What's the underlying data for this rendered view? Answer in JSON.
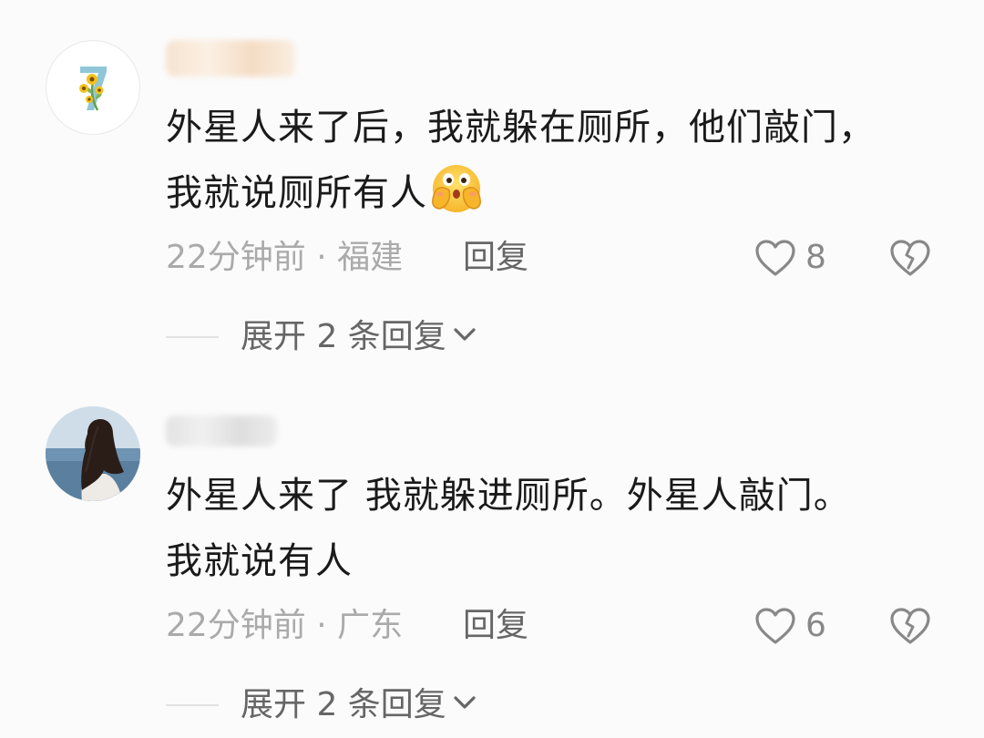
{
  "comments": [
    {
      "text_line1": "外星人来了后，我就躲在厕所，他们敲门，",
      "text_line2": "我就说厕所有人",
      "time": "22分钟前",
      "separator": "·",
      "location": "福建",
      "reply_label": "回复",
      "like_count": "8",
      "expand_label": "展开 2 条回复",
      "has_emoji": true
    },
    {
      "text_line1": "外星人来了 我就躲进厕所。外星人敲门。",
      "text_line2": "我就说有人",
      "time": "22分钟前",
      "separator": "·",
      "location": "广东",
      "reply_label": "回复",
      "like_count": "6",
      "expand_label": "展开 2 条回复",
      "has_emoji": false
    }
  ],
  "colors": {
    "background": "#fbfbfb",
    "text_primary": "#1a1a1a",
    "text_meta": "#aaaaaa",
    "text_secondary": "#666666",
    "icon": "#888888"
  },
  "icons": [
    "heart-icon",
    "broken-heart-icon",
    "chevron-down-icon",
    "covering-face-emoji"
  ]
}
